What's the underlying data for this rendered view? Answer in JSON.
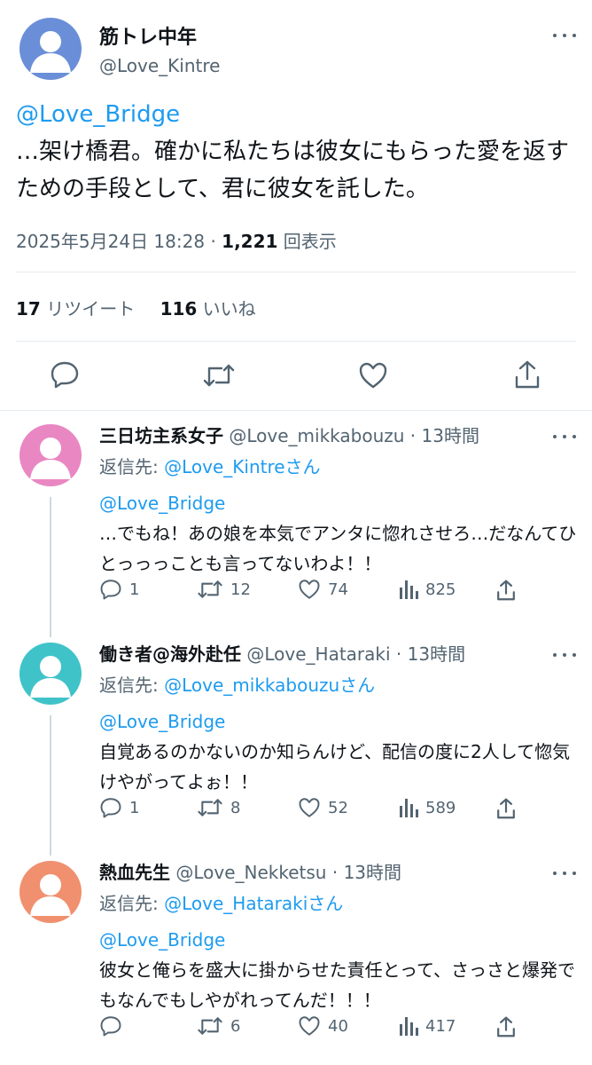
{
  "main_tweet": {
    "name": "筋トレ中年",
    "handle": "@Love_Kintre",
    "mention": "@Love_Bridge",
    "text": "…架け橋君。確かに私たちは彼女にもらった愛を返すための手段として、君に彼女を託した。",
    "date": "2025年5月24日 18:28",
    "separator": "·",
    "views": "1,221",
    "views_label": "回表示",
    "retweets": "17",
    "retweets_label": "リツイート",
    "likes": "116",
    "likes_label": "いいね",
    "avatar_color": "#6a8fd8"
  },
  "replies": [
    {
      "name": "三日坊主系女子",
      "handle": "@Love_mikkabouzu",
      "dot": "·",
      "time": "13時間",
      "reply_to_label": "返信先:",
      "reply_to_handle": "@Love_Kintreさん",
      "mention": "@Love_Bridge",
      "text": "…でもね！あの娘を本気でアンタに惚れさせろ…だなんてひとっっっことも言ってないわよ！！",
      "replies": "1",
      "retweets": "12",
      "likes": "74",
      "views": "825",
      "avatar_color": "#e987c2"
    },
    {
      "name": "働き者@海外赴任",
      "handle": "@Love_Hataraki",
      "dot": "·",
      "time": "13時間",
      "reply_to_label": "返信先:",
      "reply_to_handle": "@Love_mikkabouzuさん",
      "mention": "@Love_Bridge",
      "text": "自覚あるのかないのか知らんけど、配信の度に2人して惚気けやがってよぉ！！",
      "replies": "1",
      "retweets": "8",
      "likes": "52",
      "views": "589",
      "avatar_color": "#3fc3c9"
    },
    {
      "name": "熱血先生",
      "handle": "@Love_Nekketsu",
      "dot": "·",
      "time": "13時間",
      "reply_to_label": "返信先:",
      "reply_to_handle": "@Love_Hatarakiさん",
      "mention": "@Love_Bridge",
      "text": "彼女と俺らを盛大に掛からせた責任とって、さっさと爆発でもなんでもしやがれってんだ！！！",
      "replies": "",
      "retweets": "6",
      "likes": "40",
      "views": "417",
      "avatar_color": "#f0906f"
    }
  ],
  "icons": {
    "reply": "speech-bubble-icon",
    "retweet": "retweet-arrows-icon",
    "like": "heart-icon",
    "views": "bar-chart-icon",
    "share": "share-upload-icon",
    "more": "three-dots-icon"
  },
  "colors": {
    "link": "#1d9bf0",
    "secondary_text": "#536471",
    "primary_text": "#0f1419",
    "divider": "#e6ecf0"
  }
}
